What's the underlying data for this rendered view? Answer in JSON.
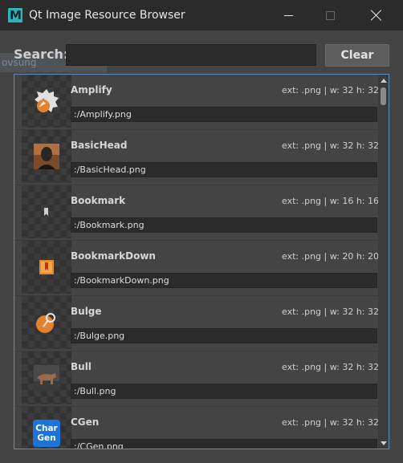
{
  "window": {
    "title": "Qt Image Resource Browser",
    "app_icon_letter": "M"
  },
  "background_tab": {
    "label": "ovsung"
  },
  "search": {
    "label": "Search:",
    "value": "",
    "placeholder": ""
  },
  "clear_button": {
    "label": "Clear"
  },
  "colors": {
    "window_bg": "#444444",
    "titlebar_bg": "#2b2b2b",
    "accent_border": "#5d8ec0",
    "field_bg": "#2b2b2b",
    "cgen_blue": "#1d74d8"
  },
  "resources": [
    {
      "name": "Amplify",
      "meta": "ext: .png | w: 32 h: 32",
      "path": ":/Amplify.png",
      "icon": "amplify-icon"
    },
    {
      "name": "BasicHead",
      "meta": "ext: .png | w: 32 h: 32",
      "path": ":/BasicHead.png",
      "icon": "basic-head-icon"
    },
    {
      "name": "Bookmark",
      "meta": "ext: .png | w: 16 h: 16",
      "path": ":/Bookmark.png",
      "icon": "bookmark-icon"
    },
    {
      "name": "BookmarkDown",
      "meta": "ext: .png | w: 20 h: 20",
      "path": ":/BookmarkDown.png",
      "icon": "bookmark-down-icon"
    },
    {
      "name": "Bulge",
      "meta": "ext: .png | w: 32 h: 32",
      "path": ":/Bulge.png",
      "icon": "bulge-icon"
    },
    {
      "name": "Bull",
      "meta": "ext: .png | w: 32 h: 32",
      "path": ":/Bull.png",
      "icon": "bull-icon"
    },
    {
      "name": "CGen",
      "meta": "ext: .png | w: 32 h: 32",
      "path": ":/CGen.png",
      "icon": "cgen-icon",
      "icon_text": [
        "Char",
        "Gen"
      ]
    }
  ]
}
